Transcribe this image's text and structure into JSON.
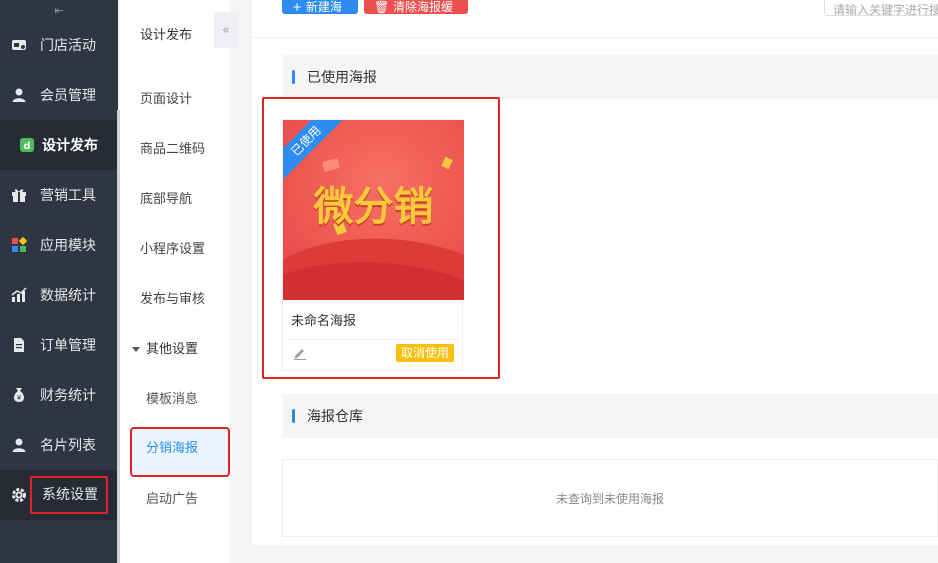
{
  "sidebar": {
    "collapse_glyph": "⇤",
    "items": [
      {
        "label": "门店活动",
        "icon": "store-icon"
      },
      {
        "label": "会员管理",
        "icon": "user-icon"
      },
      {
        "label": "设计发布",
        "icon": "design-icon",
        "active": true
      },
      {
        "label": "营销工具",
        "icon": "gift-icon"
      },
      {
        "label": "应用模块",
        "icon": "apps-icon"
      },
      {
        "label": "数据统计",
        "icon": "chart-icon"
      },
      {
        "label": "订单管理",
        "icon": "document-icon"
      },
      {
        "label": "财务统计",
        "icon": "money-bag-icon"
      },
      {
        "label": "名片列表",
        "icon": "user-icon"
      },
      {
        "label": "系统设置",
        "icon": "gear-icon",
        "highlighted": true
      }
    ]
  },
  "submenu": {
    "header": "设计发布",
    "toggle_glyph": "«",
    "items": [
      "页面设计",
      "商品二维码",
      "底部导航",
      "小程序设置",
      "发布与审核"
    ],
    "group": {
      "label": "其他设置",
      "children": [
        "模板消息",
        "分销海报",
        "启动广告"
      ],
      "active": "分销海报"
    }
  },
  "toolbar": {
    "new_button": "+ 新建海报",
    "clear_button": "🗑 清除海报缓存",
    "search_placeholder": "请输入关键字进行搜"
  },
  "sections": {
    "used": {
      "title": "已使用海报",
      "card": {
        "ribbon": "已使用",
        "poster_text": "微分销",
        "name": "未命名海报",
        "cancel_label": "取消使用"
      }
    },
    "warehouse": {
      "title": "海报仓库",
      "empty_text": "未查询到未使用海报"
    }
  },
  "colors": {
    "sidebar_bg": "#2f3542",
    "accent_blue": "#2d8cf0",
    "danger_red": "#ed4f4f",
    "warning_yellow": "#f9c00b",
    "annotation_red": "#e02323"
  }
}
